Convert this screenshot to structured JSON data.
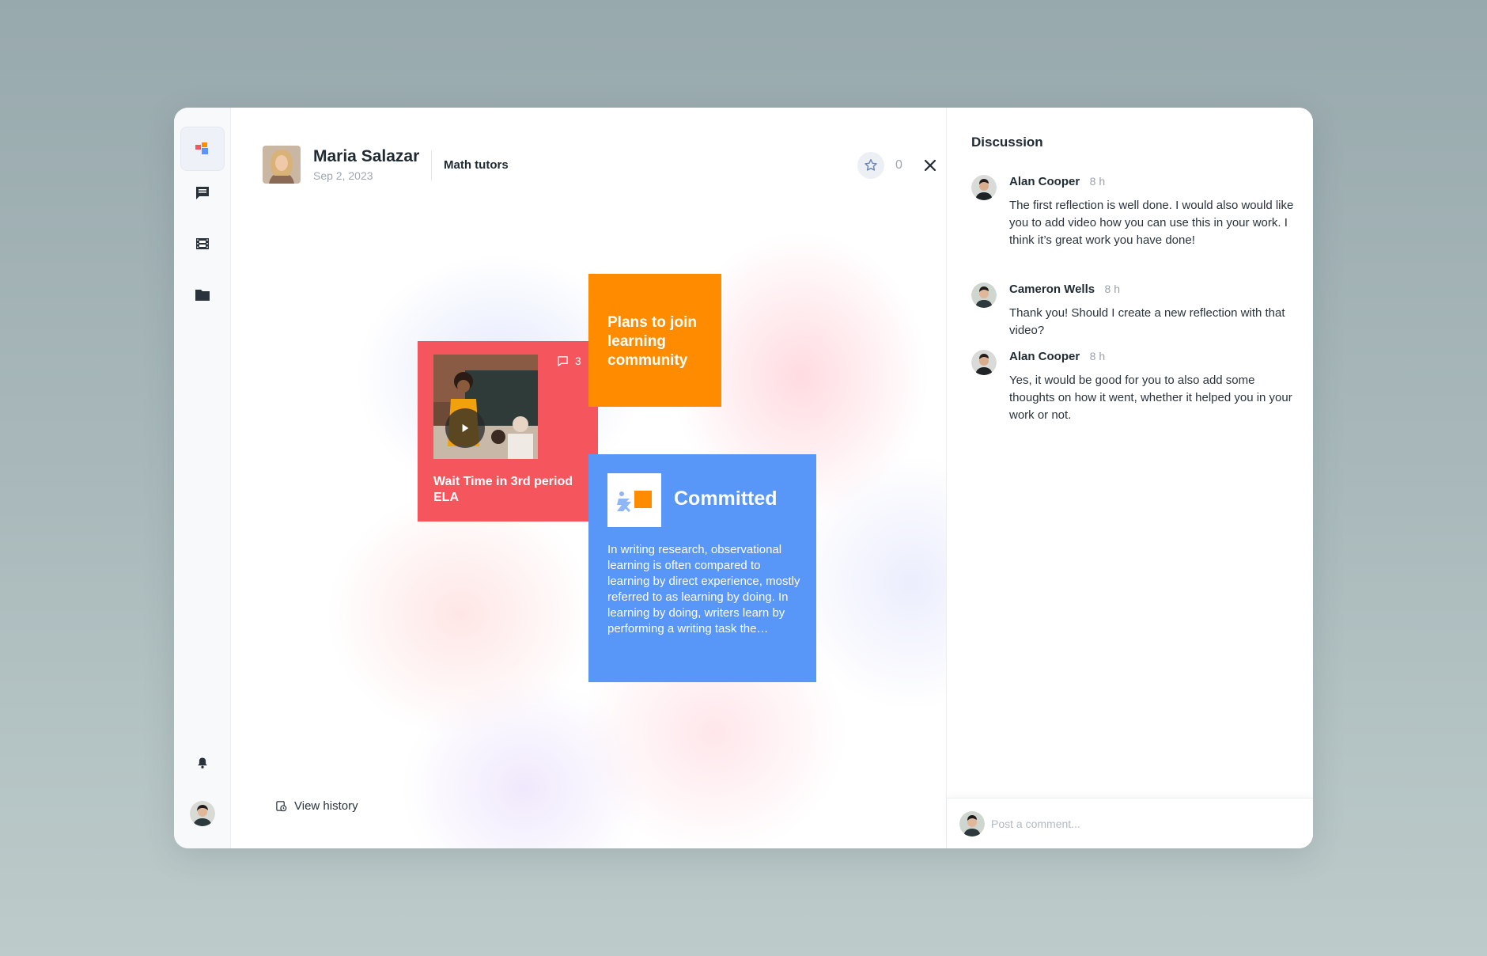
{
  "post": {
    "author": "Maria Salazar",
    "date": "Sep 2, 2023",
    "group": "Math tutors",
    "star_count": "0"
  },
  "cards": {
    "video": {
      "title": "Wait Time in 3rd period ELA",
      "comment_count": "3",
      "color": "#f5555d"
    },
    "note": {
      "title": "Plans to join learning community",
      "color": "#ff8c00"
    },
    "article": {
      "title": "Committed",
      "body": "In writing research, observational learning is often compared to learning by direct experience, mostly referred to as learning by doing. In learning by doing, writers learn by performing a writing task the…",
      "color": "#5896f7"
    }
  },
  "footer": {
    "view_history": "View history"
  },
  "discussion": {
    "title": "Discussion",
    "comments": [
      {
        "name": "Alan Cooper",
        "time": "8 h",
        "text": "The first reflection is well done. I would also would like you to add video how you can use this in your work. I think it’s great work you have done!"
      },
      {
        "name": "Cameron Wells",
        "time": "8 h",
        "text": "Thank you! Should I create a new reflection with that video?"
      },
      {
        "name": "Alan Cooper",
        "time": "8 h",
        "text": "Yes, it would be good for you to also add some thoughts on how it went, whether it helped you in your work or not."
      }
    ],
    "composer_placeholder": "Post a comment..."
  },
  "icons": {
    "rail": [
      "board-icon",
      "chat-icon",
      "film-icon",
      "folder-icon",
      "bell-icon"
    ],
    "header": [
      "star-icon",
      "close-icon"
    ]
  },
  "colors": {
    "accent_blue": "#5896f7",
    "accent_red": "#f5555d",
    "accent_orange": "#ff8c00"
  }
}
